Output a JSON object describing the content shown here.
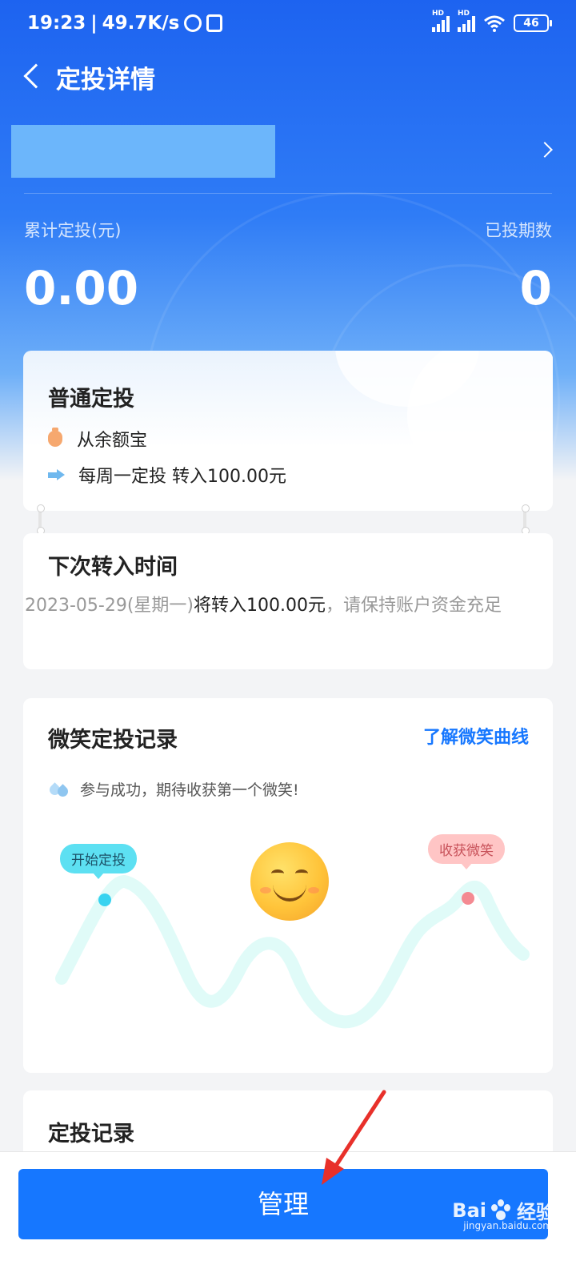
{
  "status_bar": {
    "time": "19:23",
    "separator": "|",
    "net_speed": "49.7K/s",
    "signal_tag": "HD",
    "battery": "46"
  },
  "nav": {
    "title": "定投详情"
  },
  "summary": {
    "total_label": "累计定投(元)",
    "total_value": "0.00",
    "periods_label": "已投期数",
    "periods_value": "0"
  },
  "plan": {
    "title": "普通定投",
    "source": "从余额宝",
    "schedule": "每周一定投 转入100.00元"
  },
  "next_transfer": {
    "title": "下次转入时间",
    "date_text": "2023-05-29(星期一)",
    "amount_text": "将转入100.00元",
    "note": "，请保持账户资金充足"
  },
  "smile": {
    "title": "微笑定投记录",
    "learn_link": "了解微笑曲线",
    "tip": "参与成功，期待收获第一个微笑!",
    "start_tag": "开始定投",
    "harvest_tag": "收获微笑",
    "curve_color": "#e0fbf8",
    "start_dot_color": "#38d3f0",
    "end_dot_color": "#f48a92"
  },
  "records": {
    "title": "定投记录"
  },
  "footer": {
    "manage_label": "管理"
  },
  "watermark": {
    "brand": "Bai",
    "brand_suffix": "经验",
    "url": "jingyan.baidu.com"
  },
  "colors": {
    "primary": "#1677ff",
    "hero_top": "#1d63f0",
    "annotation_arrow": "#e8302a"
  }
}
